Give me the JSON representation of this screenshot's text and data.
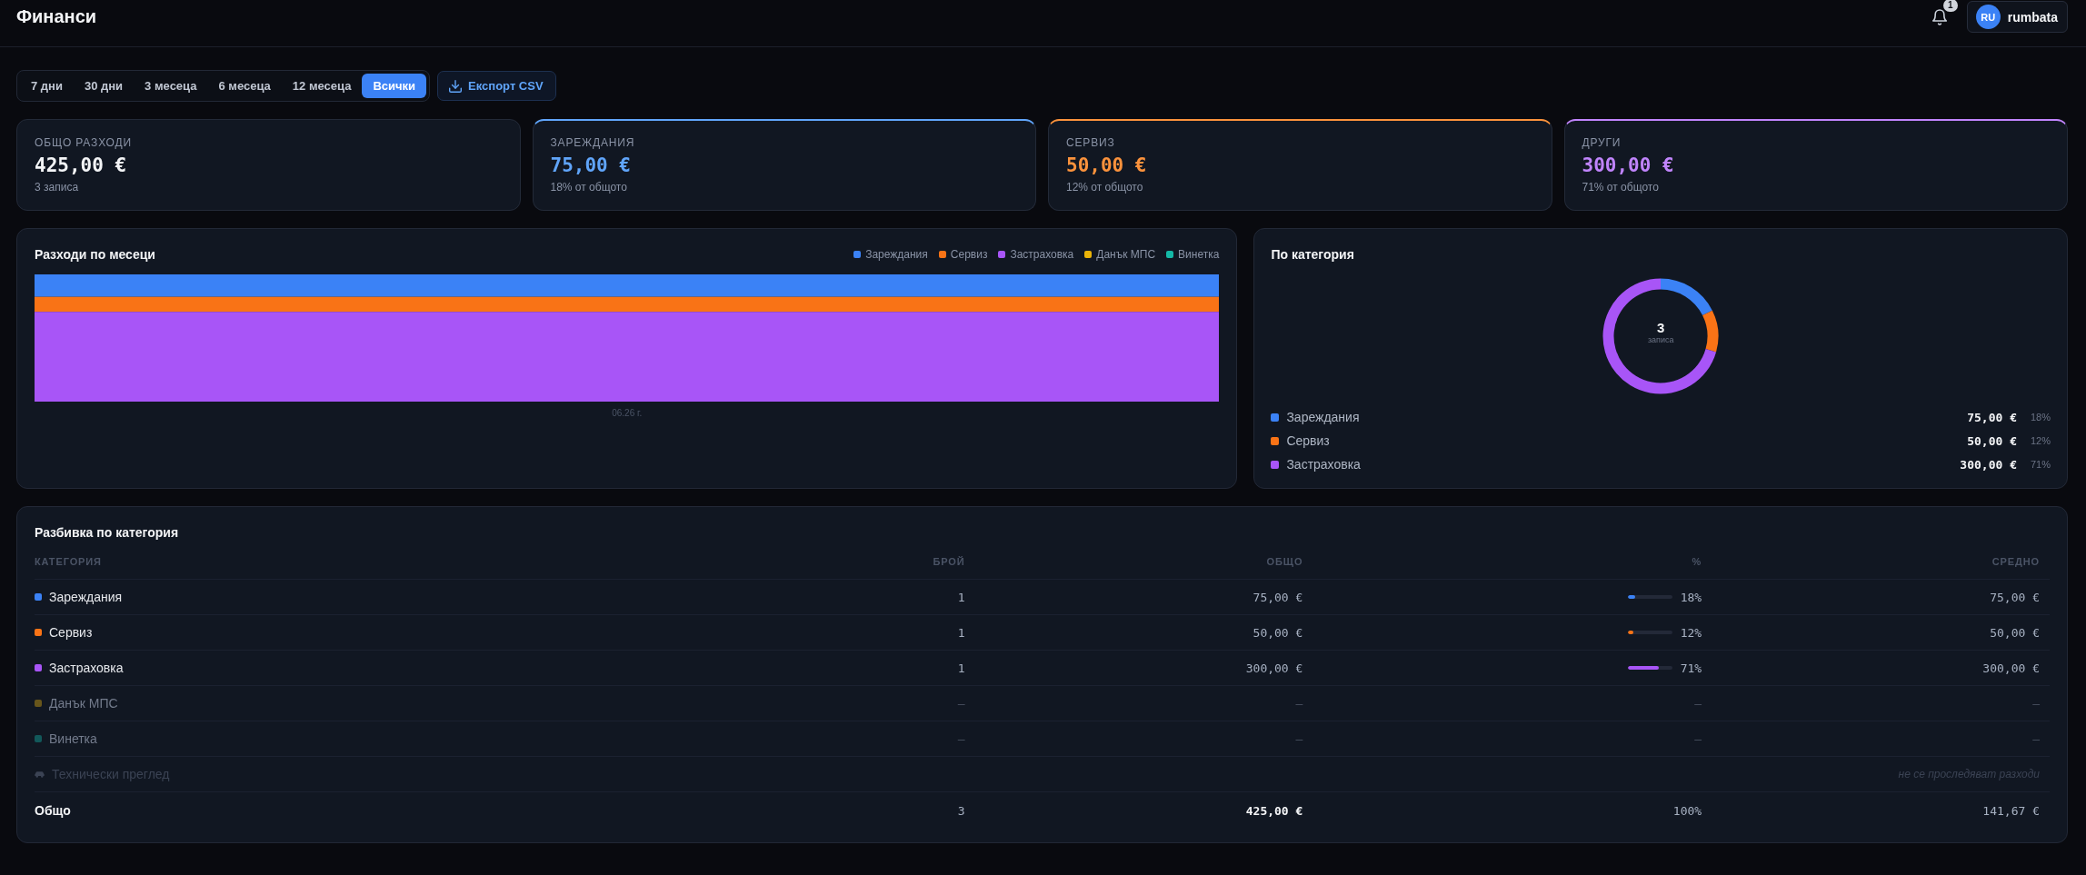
{
  "header": {
    "title": "Финанси",
    "notifications": {
      "count": "1"
    },
    "user": {
      "initials": "RU",
      "name": "rumbata"
    }
  },
  "toolbar": {
    "periods": [
      {
        "label": "7 дни",
        "selected": false
      },
      {
        "label": "30 дни",
        "selected": false
      },
      {
        "label": "3 месеца",
        "selected": false
      },
      {
        "label": "6 месеца",
        "selected": false
      },
      {
        "label": "12 месеца",
        "selected": false
      },
      {
        "label": "Всички",
        "selected": true
      }
    ],
    "export_button": "Експорт CSV"
  },
  "summary_cards": [
    {
      "kind": "total",
      "label": "ОБЩО РАЗХОДИ",
      "value": "425,00 €",
      "note": "3 записа"
    },
    {
      "kind": "category",
      "label": "ЗАРЕЖДАНИЯ",
      "value": "75,00 €",
      "note": "18% от общото",
      "color": "#60a5fa"
    },
    {
      "kind": "category",
      "label": "СЕРВИЗ",
      "value": "50,00 €",
      "note": "12% от общото",
      "color": "#fb923c"
    },
    {
      "kind": "category",
      "label": "ДРУГИ",
      "value": "300,00 €",
      "note": "71% от общото",
      "color": "#c084fc"
    }
  ],
  "monthly_chart": {
    "title": "Разходи по месеци",
    "legend": [
      {
        "label": "Зареждания",
        "color": "#3b82f6"
      },
      {
        "label": "Сервиз",
        "color": "#f97316"
      },
      {
        "label": "Застраховка",
        "color": "#a855f7"
      },
      {
        "label": "Данък МПС",
        "color": "#eab308"
      },
      {
        "label": "Винетка",
        "color": "#14b8a6"
      }
    ],
    "x_labels": [
      "06.26 г."
    ]
  },
  "category_panel": {
    "title": "По категория",
    "center_value": "3",
    "center_label": "записа",
    "chart_data": {
      "type": "donut",
      "categories": [
        "Зареждания",
        "Сервиз",
        "Застраховка"
      ],
      "values": [
        75,
        50,
        300
      ],
      "value_labels": [
        "75,00 €",
        "50,00 €",
        "300,00 €"
      ],
      "legend": "bottom"
    },
    "legend": [
      {
        "color": "#3b82f6",
        "share": "18%"
      },
      {
        "color": "#f97316",
        "share": "12%"
      },
      {
        "color": "#a855f7",
        "share": "71%"
      }
    ]
  },
  "breakdown": {
    "title": "Разбивка по категория",
    "columns": [
      "КАТЕГОРИЯ",
      "БРОЙ",
      "ОБЩО",
      "%",
      "СРЕДНО"
    ],
    "rows": [
      {
        "kind": "data",
        "category": "Зареждания",
        "color": "#3b82f6",
        "count": "1",
        "total": "75,00 €",
        "level": 0.18,
        "share": "18%",
        "average": "75,00 €"
      },
      {
        "kind": "data",
        "category": "Сервиз",
        "color": "#f97316",
        "count": "1",
        "total": "50,00 €",
        "level": 0.12,
        "share": "12%",
        "average": "50,00 €"
      },
      {
        "kind": "data",
        "category": "Застраховка",
        "color": "#a855f7",
        "count": "1",
        "total": "300,00 €",
        "level": 0.71,
        "share": "71%",
        "average": "300,00 €"
      },
      {
        "kind": "empty",
        "category": "Данък МПС",
        "color": "#68561b",
        "count": "—",
        "total": "—",
        "share": "—",
        "average": "—"
      },
      {
        "kind": "empty",
        "category": "Винетка",
        "color": "#12585a",
        "count": "—",
        "total": "—",
        "share": "—",
        "average": "—"
      },
      {
        "kind": "untracked",
        "category": "Технически преглед",
        "note": "не се проследяват разходи"
      }
    ],
    "total_row": {
      "label": "Общо",
      "count": "3",
      "total": "425,00 €",
      "share": "100%",
      "average": "141,67 €"
    }
  }
}
